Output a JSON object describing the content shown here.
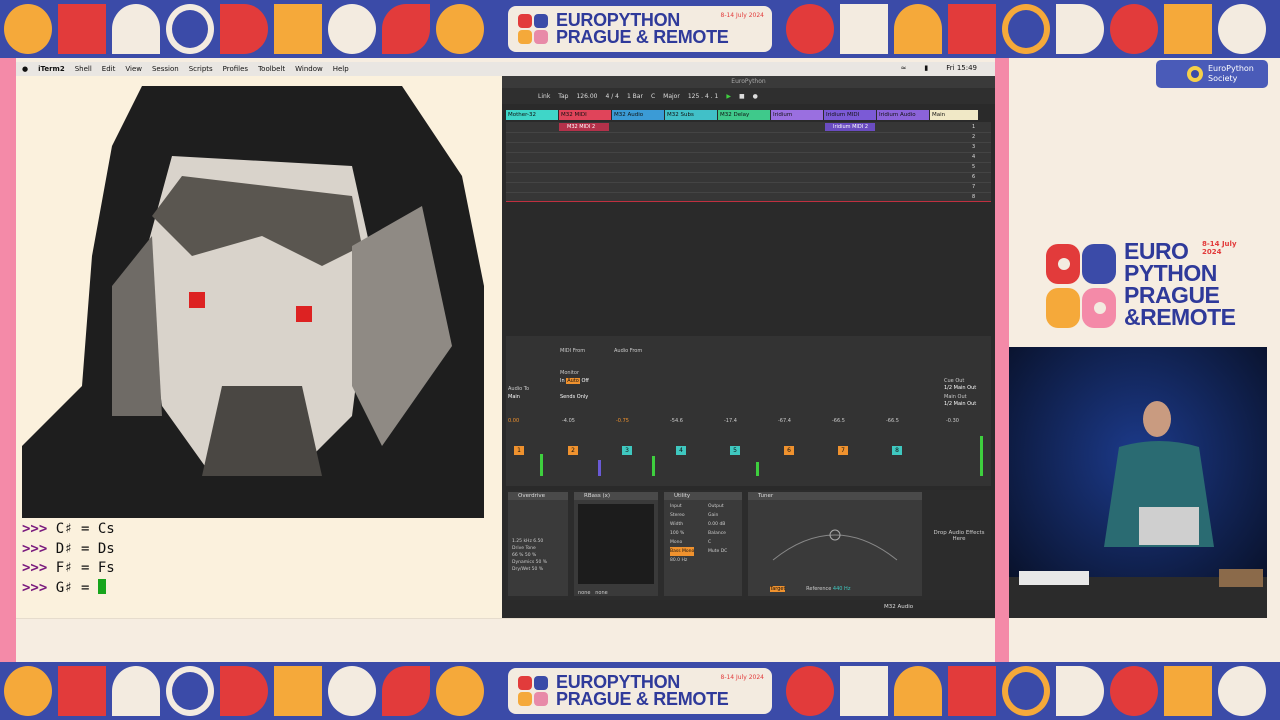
{
  "banner": {
    "line1": "EUROPYTHON",
    "line2": "PRAGUE & REMOTE",
    "date": "8-14 July 2024"
  },
  "menubar": {
    "app": "iTerm2",
    "items": [
      "Shell",
      "Edit",
      "View",
      "Session",
      "Scripts",
      "Profiles",
      "Toolbelt",
      "Window",
      "Help"
    ],
    "clock": "Fri 15:49"
  },
  "repl": {
    "prompt": ">>>",
    "lines": [
      {
        "code": "C♯ = Cs"
      },
      {
        "code": "D♯ = Ds"
      },
      {
        "code": "F♯ = Fs"
      },
      {
        "code": "G♯ = "
      }
    ]
  },
  "ableton": {
    "title": "EuroPython",
    "transport": {
      "link": "Link",
      "tap": "Tap",
      "tempo": "126.00",
      "signature": "4 / 4",
      "quant": "1 Bar",
      "key": "C",
      "scale": "Major",
      "position": "125 . 4 . 1"
    },
    "tracks": [
      {
        "name": "Mother-32",
        "color": "#3fd6c8"
      },
      {
        "name": "M32 MIDI",
        "color": "#e0445a"
      },
      {
        "name": "M32 Audio",
        "color": "#3b9bd6"
      },
      {
        "name": "M32 Subs",
        "color": "#41c0c8"
      },
      {
        "name": "M32 Delay",
        "color": "#3fc98b"
      },
      {
        "name": "Iridium",
        "color": "#9a6fe0"
      },
      {
        "name": "Iridium MIDI",
        "color": "#7b5ad6"
      },
      {
        "name": "Iridium Audio",
        "color": "#8b63d9"
      },
      {
        "name": "Main",
        "color": "#f0e8c6"
      }
    ],
    "clips": [
      "M32 MIDI 2",
      "Iridium MIDI 2"
    ],
    "scenes": [
      "1",
      "2",
      "3",
      "4",
      "5",
      "6",
      "7",
      "8"
    ],
    "routing": {
      "midi_from": "MIDI From",
      "audio_from": "Audio From",
      "monitor": "Monitor",
      "audio_to": "Audio To",
      "main": "Main",
      "sends_only": "Sends Only",
      "cue_out": "Cue Out",
      "main_out": "Main Out",
      "cue_value": "1/2 Main Out",
      "main_out_value": "1/2 Main Out",
      "in_label": "In",
      "auto_label": "Auto",
      "off_label": "Off"
    },
    "channels": [
      {
        "num": "1",
        "db": "0.00",
        "color": "#f0922e"
      },
      {
        "num": "2",
        "db": "-4.05",
        "color": "#f0922e"
      },
      {
        "num": "3",
        "db": "-0.75",
        "color": "#3fc8c0"
      },
      {
        "num": "4",
        "db": "-54.6",
        "color": "#3fc8c0"
      },
      {
        "num": "5",
        "db": "-17.4",
        "color": "#3fc8c0"
      },
      {
        "num": "6",
        "db": "-67.4",
        "color": "#f0922e"
      },
      {
        "num": "7",
        "db": "-66.5",
        "color": "#f0922e"
      },
      {
        "num": "8",
        "db": "-66.5",
        "color": "#3fc8c0"
      }
    ],
    "master_db": "-0.30",
    "devices": [
      {
        "name": "Overdrive",
        "params": [
          "1.25 kHz",
          "6.50",
          "Drive",
          "Tone",
          "66 %",
          "50 %",
          "Dynamics",
          "50 %",
          "Dry/Wet",
          "50 %"
        ]
      },
      {
        "name": "RBass (x)",
        "params": [
          "none",
          "none"
        ]
      },
      {
        "name": "Utility",
        "params": [
          "Input",
          "Output",
          "Stereo",
          "Width",
          "100 %",
          "Mono",
          "Bass Mono",
          "80.0 Hz",
          "Gain",
          "0.00 dB",
          "Balance",
          "C",
          "Mute",
          "DC"
        ]
      },
      {
        "name": "Tuner",
        "params": [
          "Target",
          "Reference",
          "440 Hz"
        ]
      }
    ],
    "drop_hint": "Drop Audio Effects Here",
    "status_track": "M32 Audio"
  },
  "badge": {
    "name_line1": "EuroPython",
    "name_line2": "Society"
  },
  "conf_logo": {
    "line1": "EURO",
    "line2": "PYTHON",
    "line3": "PRAGUE",
    "line4": "&REMOTE",
    "date": "8-14 July 2024"
  },
  "colors": {
    "banner_blue": "#3b4ba8",
    "accent_pink": "#f48aa8",
    "cream": "#fbf1dd",
    "prompt_purple": "#7a1a7e",
    "cursor_green": "#17a51c"
  }
}
